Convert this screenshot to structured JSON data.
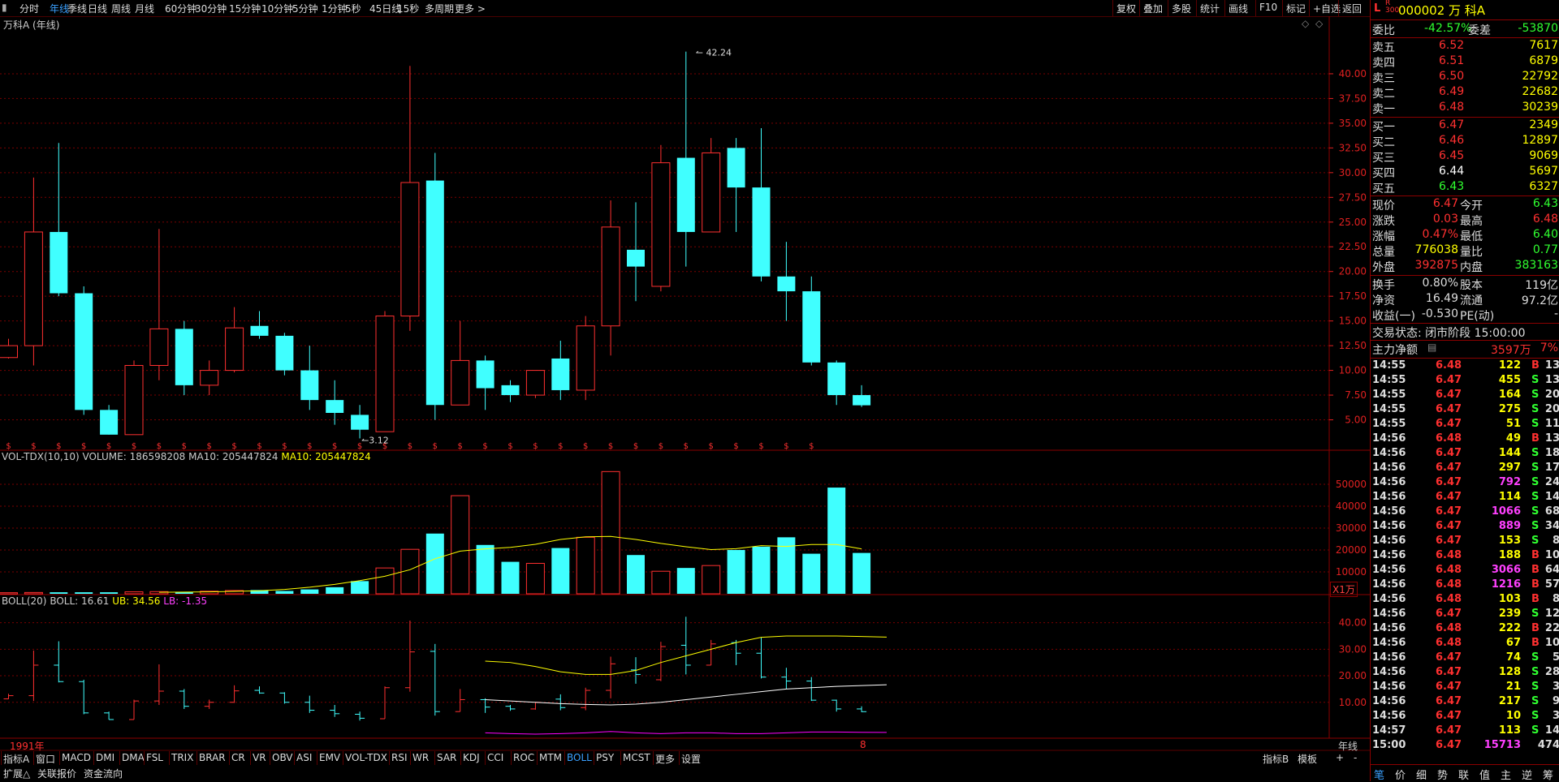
{
  "toolbar": {
    "periods": [
      "分时",
      "年线",
      "季线",
      "日线",
      "周线",
      "月线",
      "60分钟",
      "30分钟",
      "15分钟",
      "10分钟",
      "5分钟",
      "1分钟",
      "5秒",
      "45日线",
      "15秒",
      "多周期",
      "更多 >"
    ],
    "active_period": "年线",
    "right_tools": [
      "复权",
      "叠加",
      "多股",
      "统计",
      "画线",
      "F10",
      "标记",
      "+自选",
      "返回"
    ]
  },
  "chart": {
    "title": "万科A (年线)",
    "colors": {
      "up": "#ff3030",
      "down": "#40ffff",
      "grid": "#7a0000",
      "yellow": "#ffff00",
      "white": "#ffffff",
      "magenta": "#ff00ff"
    },
    "max_label": "42.24",
    "min_label": "3.12",
    "vol_legend": {
      "name": "VOL-TDX(10,10)",
      "volume": "VOLUME: 186598208",
      "ma10_white": "MA10: 205447824",
      "ma10_yellow": "MA10: 205447824"
    },
    "boll_legend": {
      "name": "BOLL(20)",
      "boll": "BOLL: 16.61",
      "ub": "UB: 34.56",
      "lb": "LB: -1.35"
    },
    "vol_unit": "X1万",
    "start_year": "1991年",
    "end_marker": "8",
    "period_label": "年线"
  },
  "chart_data": {
    "type": "candlestick",
    "title": "万科A (年线)",
    "ylim_price": [
      2.5,
      45
    ],
    "price_ticks": [
      5,
      7.5,
      10,
      12.5,
      15,
      17.5,
      20,
      22.5,
      25,
      27.5,
      30,
      32.5,
      35,
      37.5,
      40
    ],
    "price_tick_labels": [
      "5.00",
      "7.50",
      "10.00",
      "12.50",
      "15.00",
      "17.50",
      "20.00",
      "22.50",
      "25.00",
      "27.50",
      "30.00",
      "32.50",
      "35.00",
      "37.50",
      "40.00"
    ],
    "volume_ticks": [
      10000,
      20000,
      30000,
      40000,
      50000
    ],
    "volume_tick_labels": [
      "10000",
      "20000",
      "30000",
      "40000",
      "50000"
    ],
    "boll_ticks": [
      10,
      20,
      30,
      40
    ],
    "boll_tick_labels": [
      "10.00",
      "20.00",
      "30.00",
      "40.00"
    ],
    "ylim_volume": [
      0,
      60000
    ],
    "ylim_boll": [
      -2,
      46
    ],
    "candles": [
      {
        "o": 11.3,
        "h": 13.2,
        "l": 11.2,
        "c": 12.5
      },
      {
        "o": 12.5,
        "h": 29.5,
        "l": 10.5,
        "c": 24.0
      },
      {
        "o": 24.0,
        "h": 33.0,
        "l": 17.5,
        "c": 17.8
      },
      {
        "o": 17.8,
        "h": 18.5,
        "l": 5.5,
        "c": 6.0
      },
      {
        "o": 6.0,
        "h": 6.5,
        "l": 3.5,
        "c": 3.5
      },
      {
        "o": 3.5,
        "h": 11.0,
        "l": 3.5,
        "c": 10.5
      },
      {
        "o": 10.5,
        "h": 24.3,
        "l": 9.0,
        "c": 14.2
      },
      {
        "o": 14.2,
        "h": 15.0,
        "l": 7.5,
        "c": 8.5
      },
      {
        "o": 8.5,
        "h": 11.0,
        "l": 7.5,
        "c": 10.0
      },
      {
        "o": 10.0,
        "h": 16.4,
        "l": 9.8,
        "c": 14.3
      },
      {
        "o": 14.5,
        "h": 16.0,
        "l": 13.2,
        "c": 13.5
      },
      {
        "o": 13.5,
        "h": 13.8,
        "l": 9.5,
        "c": 10.0
      },
      {
        "o": 10.0,
        "h": 12.5,
        "l": 6.0,
        "c": 7.0
      },
      {
        "o": 7.0,
        "h": 9.0,
        "l": 4.5,
        "c": 5.7
      },
      {
        "o": 5.5,
        "h": 6.5,
        "l": 3.12,
        "c": 4.0
      },
      {
        "o": 3.8,
        "h": 16.0,
        "l": 3.8,
        "c": 15.5
      },
      {
        "o": 15.5,
        "h": 40.8,
        "l": 14.0,
        "c": 29.0
      },
      {
        "o": 29.2,
        "h": 32.0,
        "l": 5.0,
        "c": 6.5
      },
      {
        "o": 6.5,
        "h": 15.0,
        "l": 6.5,
        "c": 11.0
      },
      {
        "o": 11.0,
        "h": 11.5,
        "l": 6.0,
        "c": 8.2
      },
      {
        "o": 8.5,
        "h": 9.0,
        "l": 6.8,
        "c": 7.5
      },
      {
        "o": 7.5,
        "h": 10.0,
        "l": 7.2,
        "c": 10.0
      },
      {
        "o": 11.2,
        "h": 13.0,
        "l": 7.0,
        "c": 8.0
      },
      {
        "o": 8.0,
        "h": 15.5,
        "l": 7.0,
        "c": 14.5
      },
      {
        "o": 14.5,
        "h": 27.2,
        "l": 11.5,
        "c": 24.5
      },
      {
        "o": 22.2,
        "h": 27.0,
        "l": 17.0,
        "c": 20.5
      },
      {
        "o": 18.5,
        "h": 32.8,
        "l": 18.0,
        "c": 31.0
      },
      {
        "o": 31.5,
        "h": 42.24,
        "l": 20.5,
        "c": 24.0
      },
      {
        "o": 24.0,
        "h": 33.5,
        "l": 24.0,
        "c": 32.0
      },
      {
        "o": 32.5,
        "h": 33.5,
        "l": 24.0,
        "c": 28.5
      },
      {
        "o": 28.5,
        "h": 34.5,
        "l": 19.0,
        "c": 19.5
      },
      {
        "o": 19.5,
        "h": 23.0,
        "l": 15.0,
        "c": 18.0
      },
      {
        "o": 18.0,
        "h": 19.5,
        "l": 10.5,
        "c": 10.8
      },
      {
        "o": 10.8,
        "h": 11.0,
        "l": 6.5,
        "c": 7.5
      },
      {
        "o": 7.5,
        "h": 8.5,
        "l": 6.3,
        "c": 6.47
      }
    ],
    "volume": [
      500,
      600,
      700,
      700,
      700,
      900,
      1000,
      800,
      1200,
      1500,
      1700,
      1300,
      2000,
      3000,
      5800,
      11800,
      20300,
      27500,
      44800,
      22300,
      14600,
      13900,
      20900,
      25800,
      55800,
      17700,
      10300,
      11800,
      12900,
      20000,
      21500,
      25800,
      18300,
      48500,
      18660
    ],
    "vol_ma10_start": 6,
    "vol_ma10": [
      700,
      800,
      900,
      1100,
      1400,
      2000,
      3000,
      4300,
      6000,
      8000,
      11000,
      16000,
      19500,
      20500,
      21200,
      22600,
      24800,
      26000,
      26200,
      24800,
      23000,
      21500,
      20200,
      20600,
      22000,
      21600,
      22500,
      22500,
      20500
    ],
    "boll_mid_start": 19,
    "boll_mid": [
      11.0,
      10.5,
      10.0,
      9.5,
      9.2,
      9.0,
      9.3,
      10.0,
      11.0,
      12.0,
      13.0,
      14.0,
      15.0,
      15.5,
      16.0,
      16.3,
      16.61
    ],
    "boll_ub": [
      25.5,
      25.0,
      23.5,
      21.5,
      20.5,
      20.5,
      22.0,
      25.0,
      27.5,
      30.0,
      32.5,
      34.5,
      35.0,
      35.0,
      35.0,
      34.8,
      34.56
    ],
    "boll_lb": [
      -1.5,
      -1.8,
      -2.0,
      -1.8,
      -1.5,
      -1.0,
      -1.5,
      -1.8,
      -1.5,
      -1.5,
      -1.8,
      -1.8,
      -1.5,
      -1.2,
      -1.2,
      -1.3,
      -1.35
    ]
  },
  "quote": {
    "code_name": "000002 万 科A",
    "weibi_label": "委比",
    "weibi": "-42.57%",
    "weicha_label": "委差",
    "weicha": "-53870",
    "asks": [
      {
        "label": "卖五",
        "price": "6.52",
        "vol": "7617"
      },
      {
        "label": "卖四",
        "price": "6.51",
        "vol": "6879"
      },
      {
        "label": "卖三",
        "price": "6.50",
        "vol": "22792"
      },
      {
        "label": "卖二",
        "price": "6.49",
        "vol": "22682"
      },
      {
        "label": "卖一",
        "price": "6.48",
        "vol": "30239"
      }
    ],
    "bids": [
      {
        "label": "买一",
        "price": "6.47",
        "vol": "2349"
      },
      {
        "label": "买二",
        "price": "6.46",
        "vol": "12897"
      },
      {
        "label": "买三",
        "price": "6.45",
        "vol": "9069"
      },
      {
        "label": "买四",
        "price": "6.44",
        "vol": "5697"
      },
      {
        "label": "买五",
        "price": "6.43",
        "vol": "6327"
      }
    ],
    "stats": [
      {
        "l1": "现价",
        "v1": "6.47",
        "l2": "今开",
        "v2": "6.43",
        "c1": "#ff3030",
        "c2": "#30ff30"
      },
      {
        "l1": "涨跌",
        "v1": "0.03",
        "l2": "最高",
        "v2": "6.48",
        "c1": "#ff3030",
        "c2": "#ff3030"
      },
      {
        "l1": "涨幅",
        "v1": "0.47%",
        "l2": "最低",
        "v2": "6.40",
        "c1": "#ff3030",
        "c2": "#30ff30"
      },
      {
        "l1": "总量",
        "v1": "776038",
        "l2": "量比",
        "v2": "0.77",
        "c1": "#ffff00",
        "c2": "#30ff30"
      },
      {
        "l1": "外盘",
        "v1": "392875",
        "l2": "内盘",
        "v2": "383163",
        "c1": "#ff3030",
        "c2": "#30ff30"
      }
    ],
    "stats2": [
      {
        "l1": "换手",
        "v1": "0.80%",
        "l2": "股本",
        "v2": "119亿"
      },
      {
        "l1": "净资",
        "v1": "16.49",
        "l2": "流通",
        "v2": "97.2亿"
      },
      {
        "l1": "收益(一)",
        "v1": "-0.530",
        "l2": "PE(动)",
        "v2": "-"
      }
    ],
    "trade_status": "交易状态: 闭市阶段 15:00:00",
    "main_net_label": "主力净额",
    "main_net_value": "3597万",
    "main_net_pct": "7%"
  },
  "ticks": [
    {
      "t": "14:55",
      "p": "6.48",
      "v": "122",
      "bs": "B",
      "n": "13",
      "pc": "#ff3030",
      "vc": "#ffff00"
    },
    {
      "t": "14:55",
      "p": "6.47",
      "v": "455",
      "bs": "S",
      "n": "13",
      "pc": "#ff3030",
      "vc": "#ffff00"
    },
    {
      "t": "14:55",
      "p": "6.47",
      "v": "164",
      "bs": "S",
      "n": "20",
      "pc": "#ff3030",
      "vc": "#ffff00"
    },
    {
      "t": "14:55",
      "p": "6.47",
      "v": "275",
      "bs": "S",
      "n": "20",
      "pc": "#ff3030",
      "vc": "#ffff00"
    },
    {
      "t": "14:55",
      "p": "6.47",
      "v": "51",
      "bs": "S",
      "n": "11",
      "pc": "#ff3030",
      "vc": "#ffff00"
    },
    {
      "t": "14:56",
      "p": "6.48",
      "v": "49",
      "bs": "B",
      "n": "13",
      "pc": "#ff3030",
      "vc": "#ffff00"
    },
    {
      "t": "14:56",
      "p": "6.47",
      "v": "144",
      "bs": "S",
      "n": "18",
      "pc": "#ff3030",
      "vc": "#ffff00"
    },
    {
      "t": "14:56",
      "p": "6.47",
      "v": "297",
      "bs": "S",
      "n": "17",
      "pc": "#ff3030",
      "vc": "#ffff00"
    },
    {
      "t": "14:56",
      "p": "6.47",
      "v": "792",
      "bs": "S",
      "n": "24",
      "pc": "#ff3030",
      "vc": "#ff40ff"
    },
    {
      "t": "14:56",
      "p": "6.47",
      "v": "114",
      "bs": "S",
      "n": "14",
      "pc": "#ff3030",
      "vc": "#ffff00"
    },
    {
      "t": "14:56",
      "p": "6.47",
      "v": "1066",
      "bs": "S",
      "n": "68",
      "pc": "#ff3030",
      "vc": "#ff40ff"
    },
    {
      "t": "14:56",
      "p": "6.47",
      "v": "889",
      "bs": "S",
      "n": "34",
      "pc": "#ff3030",
      "vc": "#ff40ff"
    },
    {
      "t": "14:56",
      "p": "6.47",
      "v": "153",
      "bs": "S",
      "n": "8",
      "pc": "#ff3030",
      "vc": "#ffff00"
    },
    {
      "t": "14:56",
      "p": "6.48",
      "v": "188",
      "bs": "B",
      "n": "10",
      "pc": "#ff3030",
      "vc": "#ffff00"
    },
    {
      "t": "14:56",
      "p": "6.48",
      "v": "3066",
      "bs": "B",
      "n": "64",
      "pc": "#ff3030",
      "vc": "#ff40ff"
    },
    {
      "t": "14:56",
      "p": "6.48",
      "v": "1216",
      "bs": "B",
      "n": "57",
      "pc": "#ff3030",
      "vc": "#ff40ff"
    },
    {
      "t": "14:56",
      "p": "6.48",
      "v": "103",
      "bs": "B",
      "n": "8",
      "pc": "#ff3030",
      "vc": "#ffff00"
    },
    {
      "t": "14:56",
      "p": "6.47",
      "v": "239",
      "bs": "S",
      "n": "12",
      "pc": "#ff3030",
      "vc": "#ffff00"
    },
    {
      "t": "14:56",
      "p": "6.48",
      "v": "222",
      "bs": "B",
      "n": "22",
      "pc": "#ff3030",
      "vc": "#ffff00"
    },
    {
      "t": "14:56",
      "p": "6.48",
      "v": "67",
      "bs": "B",
      "n": "10",
      "pc": "#ff3030",
      "vc": "#ffff00"
    },
    {
      "t": "14:56",
      "p": "6.47",
      "v": "74",
      "bs": "S",
      "n": "5",
      "pc": "#ff3030",
      "vc": "#ffff00"
    },
    {
      "t": "14:56",
      "p": "6.47",
      "v": "128",
      "bs": "S",
      "n": "28",
      "pc": "#ff3030",
      "vc": "#ffff00"
    },
    {
      "t": "14:56",
      "p": "6.47",
      "v": "21",
      "bs": "S",
      "n": "3",
      "pc": "#ff3030",
      "vc": "#ffff00"
    },
    {
      "t": "14:56",
      "p": "6.47",
      "v": "217",
      "bs": "S",
      "n": "9",
      "pc": "#ff3030",
      "vc": "#ffff00"
    },
    {
      "t": "14:56",
      "p": "6.47",
      "v": "10",
      "bs": "S",
      "n": "3",
      "pc": "#ff3030",
      "vc": "#ffff00"
    },
    {
      "t": "14:57",
      "p": "6.47",
      "v": "113",
      "bs": "S",
      "n": "14",
      "pc": "#ff3030",
      "vc": "#ffff00"
    },
    {
      "t": "15:00",
      "p": "6.47",
      "v": "15713",
      "bs": "",
      "n": "474",
      "pc": "#ff3030",
      "vc": "#ff40ff"
    }
  ],
  "bottom_tabs": [
    "指标A",
    "窗口",
    "MACD",
    "DMI",
    "DMA",
    "FSL",
    "TRIX",
    "BRAR",
    "CR",
    "VR",
    "OBV",
    "ASI",
    "EMV",
    "VOL-TDX",
    "RSI",
    "WR",
    "SAR",
    "KDJ",
    "CCI",
    "ROC",
    "MTM",
    "BOLL",
    "PSY",
    "MCST",
    "更多",
    "设置"
  ],
  "active_tab": "BOLL",
  "bottom_right": [
    "指标B",
    "模板",
    "+",
    "-"
  ],
  "bottom_row2": [
    "扩展△",
    "关联报价",
    "资金流向"
  ],
  "rp_bottom_tabs": [
    "笔",
    "价",
    "细",
    "势",
    "联",
    "值",
    "主",
    "逆",
    "筹"
  ]
}
